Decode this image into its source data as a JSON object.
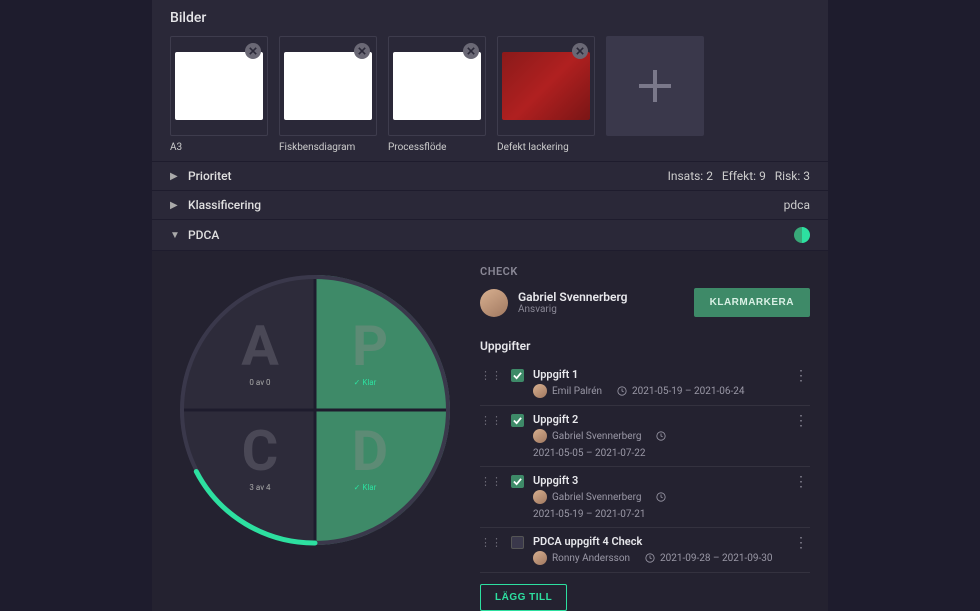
{
  "sections": {
    "images_title": "Bilder"
  },
  "images": [
    {
      "caption": "A3"
    },
    {
      "caption": "Fiskbensdiagram"
    },
    {
      "caption": "Processflöde"
    },
    {
      "caption": "Defekt lackering"
    }
  ],
  "expanders": {
    "prioritet": {
      "label": "Prioritet",
      "meta_insats_label": "Insats:",
      "meta_insats_val": "2",
      "meta_effekt_label": "Effekt:",
      "meta_effekt_val": "9",
      "meta_risk_label": "Risk:",
      "meta_risk_val": "3"
    },
    "klassificering": {
      "label": "Klassificering",
      "meta": "pdca"
    },
    "pdca": {
      "label": "PDCA"
    }
  },
  "pdca": {
    "quadrants": {
      "P": {
        "letter": "P",
        "sub_prefix": "✓ ",
        "sub": "Klar"
      },
      "D": {
        "letter": "D",
        "sub_prefix": "✓ ",
        "sub": "Klar"
      },
      "C": {
        "letter": "C",
        "sub": "3 av 4"
      },
      "A": {
        "letter": "A",
        "sub": "0 av 0"
      }
    },
    "phase_label": "CHECK",
    "owner": {
      "name": "Gabriel Svennerberg",
      "role": "Ansvarig"
    },
    "klarmarkera": "KLARMARKERA",
    "tasks_title": "Uppgifter",
    "tasks": [
      {
        "title": "Uppgift 1",
        "assignee": "Emil Palrén",
        "dates": "2021-05-19 – 2021-06-24",
        "checked": true
      },
      {
        "title": "Uppgift 2",
        "assignee": "Gabriel Svennerberg",
        "dates": "2021-05-05 – 2021-07-22",
        "checked": true
      },
      {
        "title": "Uppgift 3",
        "assignee": "Gabriel Svennerberg",
        "dates": "2021-05-19 – 2021-07-21",
        "checked": true
      },
      {
        "title": "PDCA uppgift 4 Check",
        "assignee": "Ronny Andersson",
        "dates": "2021-09-28 – 2021-09-30",
        "checked": false
      }
    ],
    "add_task": "LÄGG TILL"
  }
}
